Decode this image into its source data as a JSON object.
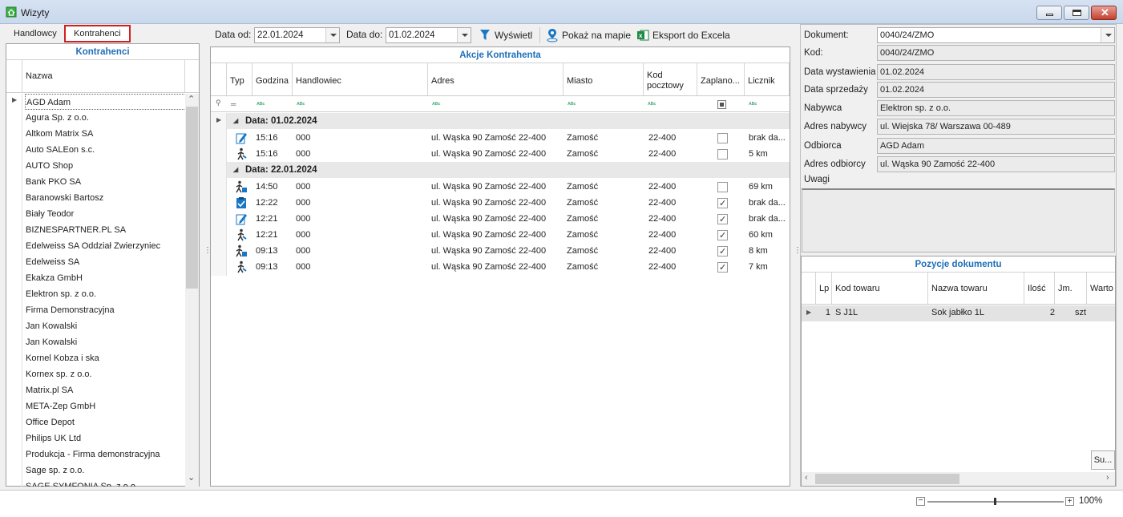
{
  "window": {
    "title": "Wizyty"
  },
  "tabs": [
    {
      "label": "Handlowcy"
    },
    {
      "label": "Kontrahenci"
    }
  ],
  "left_panel": {
    "title": "Kontrahenci",
    "column_header": "Nazwa",
    "items": [
      "AGD Adam",
      "Agura Sp. z o.o.",
      "Altkom Matrix SA",
      "Auto SALEon s.c.",
      "AUTO Shop",
      "Bank PKO SA",
      "Baranowski Bartosz",
      "Biały Teodor",
      "BIZNESPARTNER.PL SA",
      "Edelweiss SA Oddział Zwierzyniec",
      "Edelweiss SA",
      "Ekakza GmbH",
      "Elektron sp. z o.o.",
      "Firma Demonstracyjna",
      "Jan Kowalski",
      "Jan Kowalski",
      "Kornel Kobza i ska",
      "Kornex sp. z o.o.",
      "Matrix.pl SA",
      "META-Zep GmbH",
      "Office Depot",
      "Philips UK Ltd",
      "Produkcja - Firma demonstracyjna",
      "Sage sp. z o.o.",
      "SAGE SYMFONIA Sp. z o.o."
    ]
  },
  "toolbar": {
    "date_from_label": "Data od:",
    "date_from_value": "22.01.2024",
    "date_to_label": "Data do:",
    "date_to_value": "01.02.2024",
    "show_label": "Wyświetl",
    "map_label": "Pokaż na mapie",
    "excel_label": "Eksport do Excela"
  },
  "center_panel": {
    "title": "Akcje Kontrahenta",
    "columns": [
      "Typ",
      "Godzina",
      "Handlowiec",
      "Adres",
      "Miasto",
      "Kod pocztowy",
      "Zaplano...",
      "Licznik"
    ],
    "groups": [
      {
        "label": "Data: 01.02.2024",
        "rows": [
          {
            "icon": "document-edit-icon",
            "time": "15:16",
            "rep": "000",
            "addr": "ul. Wąska 90 Zamość 22-400",
            "city": "Zamość",
            "zip": "22-400",
            "planned": false,
            "counter": "brak da..."
          },
          {
            "icon": "walking-person-icon",
            "time": "15:16",
            "rep": "000",
            "addr": "ul. Wąska 90 Zamość 22-400",
            "city": "Zamość",
            "zip": "22-400",
            "planned": false,
            "counter": "5 km"
          }
        ]
      },
      {
        "label": "Data: 22.01.2024",
        "rows": [
          {
            "icon": "person-arrive-icon",
            "time": "14:50",
            "rep": "000",
            "addr": "ul. Wąska 90 Zamość 22-400",
            "city": "Zamość",
            "zip": "22-400",
            "planned": false,
            "counter": "69 km"
          },
          {
            "icon": "clipboard-check-icon",
            "time": "12:22",
            "rep": "000",
            "addr": "ul. Wąska 90 Zamość 22-400",
            "city": "Zamość",
            "zip": "22-400",
            "planned": true,
            "counter": "brak da..."
          },
          {
            "icon": "document-edit-icon",
            "time": "12:21",
            "rep": "000",
            "addr": "ul. Wąska 90 Zamość 22-400",
            "city": "Zamość",
            "zip": "22-400",
            "planned": true,
            "counter": "brak da..."
          },
          {
            "icon": "walking-person-icon",
            "time": "12:21",
            "rep": "000",
            "addr": "ul. Wąska 90 Zamość 22-400",
            "city": "Zamość",
            "zip": "22-400",
            "planned": true,
            "counter": "60 km"
          },
          {
            "icon": "person-arrive-icon",
            "time": "09:13",
            "rep": "000",
            "addr": "ul. Wąska 90 Zamość 22-400",
            "city": "Zamość",
            "zip": "22-400",
            "planned": true,
            "counter": "8 km"
          },
          {
            "icon": "walking-person-icon",
            "time": "09:13",
            "rep": "000",
            "addr": "ul. Wąska 90 Zamość 22-400",
            "city": "Zamość",
            "zip": "22-400",
            "planned": true,
            "counter": "7 km"
          }
        ]
      }
    ]
  },
  "right_panel": {
    "fields": [
      {
        "label": "Dokument:",
        "value": "0040/24/ZMO"
      },
      {
        "label": "Kod:",
        "value": "0040/24/ZMO"
      },
      {
        "label": "Data wystawienia",
        "value": "01.02.2024"
      },
      {
        "label": "Data sprzedaży",
        "value": "01.02.2024"
      },
      {
        "label": "Nabywca",
        "value": "Elektron sp. z o.o."
      },
      {
        "label": "Adres nabywcy",
        "value": "ul. Wiejska 78/ Warszawa 00-489"
      },
      {
        "label": "Odbiorca",
        "value": "AGD Adam"
      },
      {
        "label": "Adres odbiorcy",
        "value": "ul. Wąska 90 Zamość 22-400"
      }
    ],
    "notes_label": "Uwagi",
    "positions_title": "Pozycje dokumentu",
    "positions_columns": [
      "Lp",
      "Kod towaru",
      "Nazwa towaru",
      "Ilość",
      "Jm.",
      "Warto"
    ],
    "positions_rows": [
      {
        "lp": "1",
        "code": "S J1L",
        "name": "Sok jabłko 1L",
        "qty": "2",
        "unit": "szt"
      }
    ],
    "sum_button": "Su..."
  },
  "status": {
    "zoom": "100%"
  }
}
